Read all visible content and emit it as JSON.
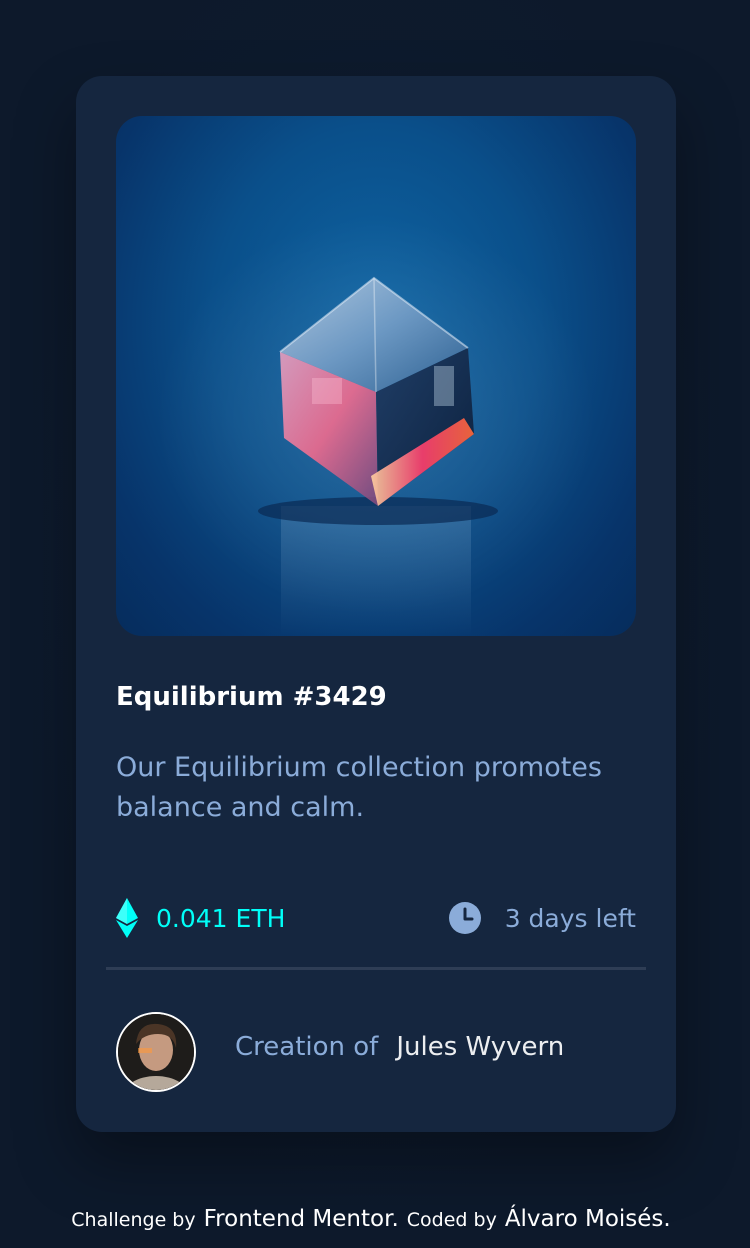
{
  "card": {
    "title": "Equilibrium #3429",
    "description": "Our Equilibrium collection promotes balance and calm.",
    "price": "0.041 ETH",
    "time_left": "3 days left",
    "creator_prefix": "Creation of",
    "creator_name": "Jules Wyvern",
    "image": "cube-equilibrium-image",
    "price_icon": "ethereum-icon",
    "time_icon": "clock-icon"
  },
  "attribution": {
    "challenge_prefix": "Challenge by",
    "challenge_link": "Frontend Mentor.",
    "coded_prefix": "Coded by",
    "coded_link": "Álvaro Moisés."
  },
  "colors": {
    "background": "#0d192b",
    "card": "#15263f",
    "accent": "#00fff8",
    "soft_blue": "#8bacd9",
    "white": "#ffffff"
  }
}
